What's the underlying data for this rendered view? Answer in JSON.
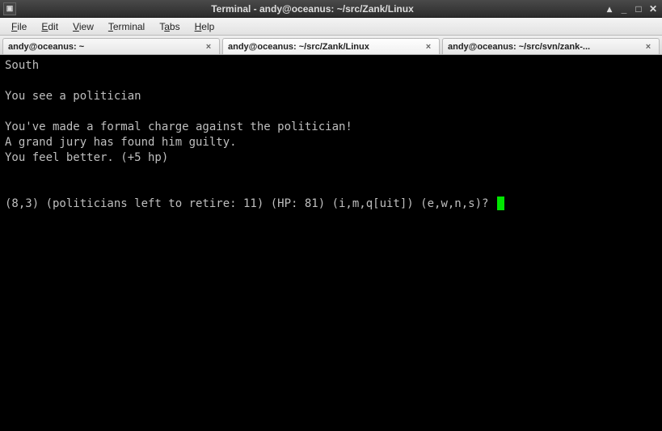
{
  "window": {
    "title": "Terminal - andy@oceanus: ~/src/Zank/Linux"
  },
  "menu": {
    "items": [
      {
        "label": "File",
        "u": "F"
      },
      {
        "label": "Edit",
        "u": "E"
      },
      {
        "label": "View",
        "u": "V"
      },
      {
        "label": "Terminal",
        "u": "T"
      },
      {
        "label": "Tabs",
        "u": "a"
      },
      {
        "label": "Help",
        "u": "H"
      }
    ]
  },
  "tabs": [
    {
      "label": "andy@oceanus: ~",
      "active": false
    },
    {
      "label": "andy@oceanus: ~/src/Zank/Linux",
      "active": true
    },
    {
      "label": "andy@oceanus: ~/src/svn/zank-...",
      "active": false
    }
  ],
  "terminal": {
    "lines": [
      "South",
      "",
      "You see a politician",
      "",
      "You've made a formal charge against the politician!",
      "A grand jury has found him guilty.",
      "You feel better. (+5 hp)",
      "",
      ""
    ],
    "prompt": "(8,3) (politicians left to retire: 11) (HP: 81) (i,m,q[uit]) (e,w,n,s)? "
  }
}
